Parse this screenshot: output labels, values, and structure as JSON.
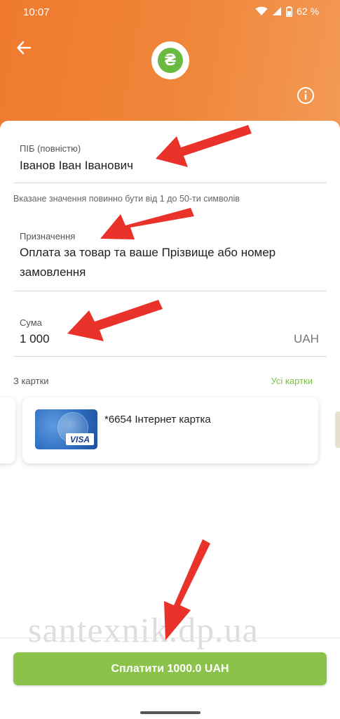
{
  "status_bar": {
    "time": "10:07",
    "battery": "62 %"
  },
  "header": {
    "logo_symbol": "₴",
    "accent_color": "#f0863a",
    "brand_green": "#6ab940"
  },
  "form": {
    "name": {
      "label": "ПІБ (повністю)",
      "value": "Іванов Іван Іванович"
    },
    "name_hint": "Вказане значення повинно бути від 1 до 50-ти символів",
    "purpose": {
      "label": "Призначення",
      "value_line1": "Оплата за товар та ваше Прізвище або номер",
      "value_line2": "замовлення"
    },
    "amount": {
      "label": "Сума",
      "value": "1 000",
      "currency": "UAH"
    }
  },
  "cards": {
    "section_label": "З картки",
    "all_cards_link": "Усі картки",
    "selected_card": {
      "name": "*6654 Інтернет картка",
      "brand": "VISA"
    }
  },
  "pay_button": {
    "label": "Сплатити 1000.0 UAH",
    "color": "#8bc34a"
  },
  "watermark": "santexnik.dp.ua",
  "icons": [
    "back-arrow-icon",
    "hryvnia-icon",
    "info-icon",
    "wifi-icon",
    "signal-icon",
    "battery-icon"
  ]
}
